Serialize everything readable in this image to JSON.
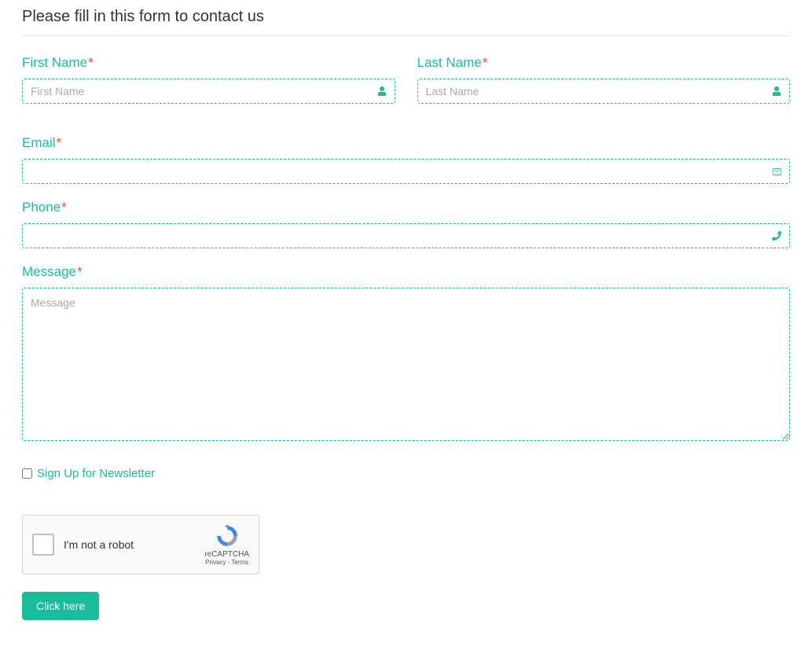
{
  "form": {
    "title": "Please fill in this form to contact us",
    "required_mark": "*",
    "fields": {
      "first_name": {
        "label": "First Name",
        "placeholder": "First Name"
      },
      "last_name": {
        "label": "Last Name",
        "placeholder": "Last Name"
      },
      "email": {
        "label": "Email",
        "placeholder": ""
      },
      "phone": {
        "label": "Phone",
        "placeholder": ""
      },
      "message": {
        "label": "Message",
        "placeholder": "Message"
      }
    },
    "newsletter": {
      "label": "Sign Up for Newsletter"
    },
    "recaptcha": {
      "label": "I'm not a robot",
      "brand": "reCAPTCHA",
      "terms": "Privacy - Terms"
    },
    "submit": {
      "label": "Click here"
    }
  }
}
